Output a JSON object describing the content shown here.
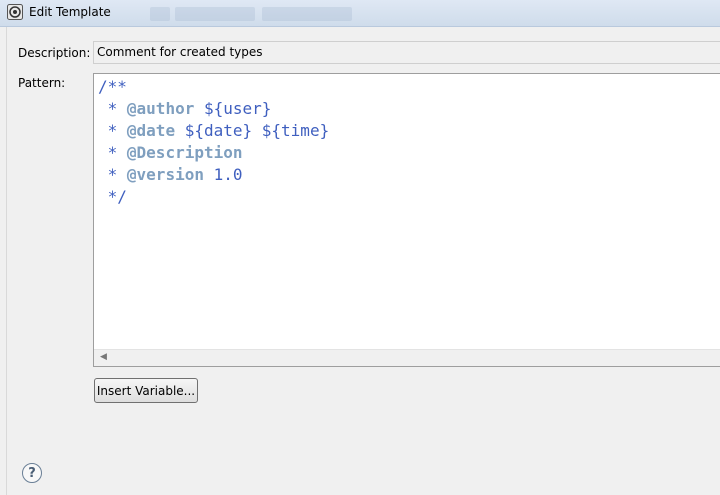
{
  "window": {
    "title": "Edit Template",
    "icon": "eclipse-icon"
  },
  "form": {
    "description_label": "Description:",
    "description_value": "Comment for created types",
    "pattern_label": "Pattern:",
    "pattern_lines": [
      "/**",
      " * @author ${user}",
      " * @date ${date} ${time}",
      " * @Description",
      " * @version 1.0",
      " */"
    ]
  },
  "buttons": {
    "insert_variable": "Insert Variable..."
  },
  "help": {
    "icon": "help-icon",
    "glyph": "?"
  },
  "colors": {
    "javadoc": "#3f5fbf",
    "javadoc_tag": "#7f9fbf"
  }
}
